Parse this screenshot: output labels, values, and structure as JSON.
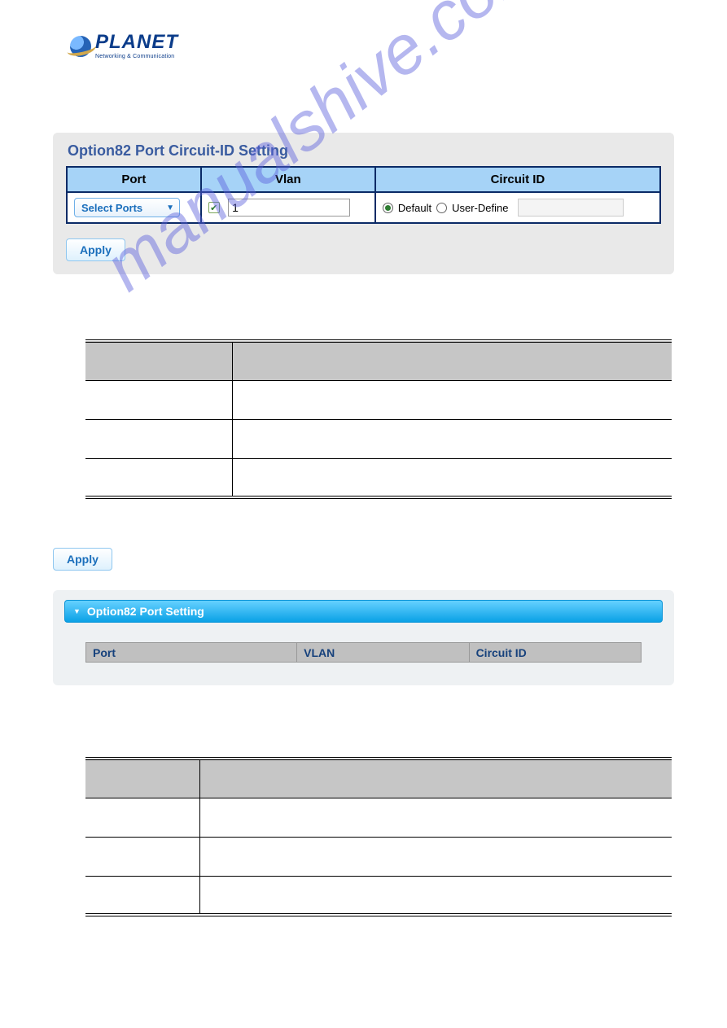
{
  "logo": {
    "brand": "PLANET",
    "tagline": "Networking & Communication"
  },
  "watermark": "manualshive.com",
  "panel1": {
    "title": "Option82 Port Circuit-ID Setting",
    "headers": {
      "port": "Port",
      "vlan": "Vlan",
      "circuit": "Circuit ID"
    },
    "port_select_label": "Select Ports",
    "vlan_value": "1",
    "radio_default": "Default",
    "radio_user": "User-Define",
    "apply": "Apply"
  },
  "standalone_apply": "Apply",
  "panel2": {
    "title": "Option82 Port Setting",
    "headers": {
      "port": "Port",
      "vlan": "VLAN",
      "circuit": "Circuit ID"
    }
  }
}
